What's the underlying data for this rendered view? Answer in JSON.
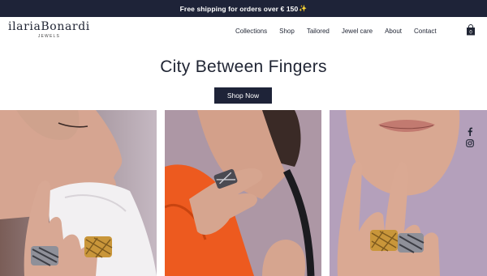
{
  "promo": {
    "text": "Free shipping for orders over € 150",
    "sparkle": "✨"
  },
  "brand": {
    "name": "ilariaBonardi",
    "tagline": "JEWELS"
  },
  "nav": {
    "items": [
      {
        "label": "Collections"
      },
      {
        "label": "Shop"
      },
      {
        "label": "Tailored"
      },
      {
        "label": "Jewel care"
      },
      {
        "label": "About"
      },
      {
        "label": "Contact"
      }
    ]
  },
  "icons": {
    "cart": "shopping-bag-icon",
    "facebook": "facebook-icon",
    "instagram": "instagram-icon"
  },
  "hero": {
    "title": "City Between Fingers",
    "cta_label": "Shop Now"
  },
  "colors": {
    "navy": "#1e2338",
    "background": "#ffffff",
    "gold": "#c9963a",
    "silver": "#8a8a92"
  }
}
